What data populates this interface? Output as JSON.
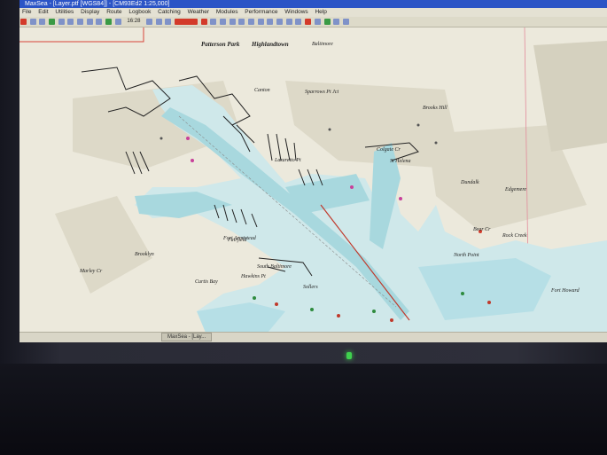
{
  "window": {
    "title": "MaxSea - [Layer.ptf [WGS84]] - [CM93Ed2 1:25,000]"
  },
  "menu": [
    {
      "label": "File"
    },
    {
      "label": "Edit"
    },
    {
      "label": "Utilities"
    },
    {
      "label": "Display"
    },
    {
      "label": "Route"
    },
    {
      "label": "Logbook"
    },
    {
      "label": "Catching"
    },
    {
      "label": "Weather"
    },
    {
      "label": "Modules"
    },
    {
      "label": "Performance"
    },
    {
      "label": "Windows"
    },
    {
      "label": "Help"
    }
  ],
  "toolbar": {
    "time": "16:28"
  },
  "map_labels": {
    "patterson_park": "Patterson Park",
    "highlandtown": "Highlandtown",
    "baltimore": "Baltimore",
    "canton": "Canton",
    "sparrows_pt": "Sparrows Pt Jct",
    "brooks_hill": "Brooks Hill",
    "lazaretto": "Lazaretto Pt",
    "colgate": "Colgate Cr",
    "st_helena": "St Helena",
    "dundalk": "Dundalk",
    "fairfield": "Fairfield",
    "brooklyn": "Brooklyn",
    "south_baltimore": "South Baltimore",
    "curtis_bay": "Curtis Bay",
    "hawkins_pt": "Hawkins Pt",
    "sollers": "Sollers",
    "edgemere": "Edgemere",
    "fort_armistead": "Fort Armistead",
    "marley_cr": "Marley Cr",
    "rock_creek": "Rock Creek",
    "north_point": "North Point",
    "bear_creek": "Bear Cr",
    "fort_howard": "Fort Howard"
  },
  "colors": {
    "land": "#ece9dc",
    "land_dark": "#ddd9c8",
    "water": "#cfe8ea",
    "channel": "#a8d8de",
    "title_bar": "#2b54c6"
  },
  "taskbar": {
    "task_label": "MaxSea - [Lay..."
  }
}
